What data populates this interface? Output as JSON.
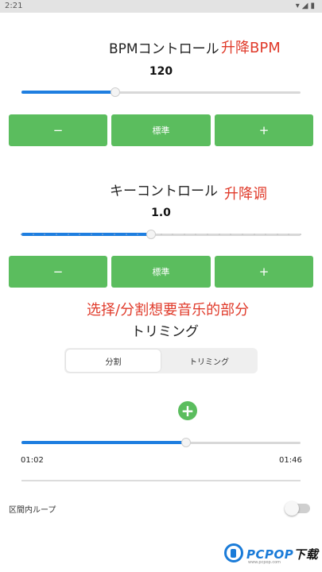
{
  "status_bar": {
    "time": "2:21",
    "icons": [
      "wifi-icon",
      "signal-icon",
      "battery-icon"
    ]
  },
  "bpm": {
    "title": "BPMコントロール",
    "annotation": "升降BPM",
    "value": "120",
    "slider_fraction": 0.335,
    "minus_label": "−",
    "standard_label": "標準",
    "plus_label": "+"
  },
  "key": {
    "title": "キーコントロール",
    "annotation": "升降调",
    "value": "1.0",
    "slider_fraction": 0.465,
    "minus_label": "−",
    "standard_label": "標準",
    "plus_label": "+"
  },
  "trim": {
    "annotation": "选择/分割想要音乐的部分",
    "title": "トリミング",
    "tabs": [
      {
        "label": "分割",
        "active": true
      },
      {
        "label": "トリミング",
        "active": false
      }
    ],
    "add_label": "+",
    "position_fraction": 0.59,
    "current_time": "01:02",
    "total_time": "01:46"
  },
  "loop": {
    "label": "区間内ループ",
    "enabled": false
  },
  "watermark": {
    "brand": "PCPOP",
    "suffix": "下载",
    "sub": "www.pcpop.com"
  },
  "colors": {
    "accent_blue": "#1e7ee0",
    "button_green": "#5bbd5e",
    "annotation_red": "#e03b2b"
  }
}
